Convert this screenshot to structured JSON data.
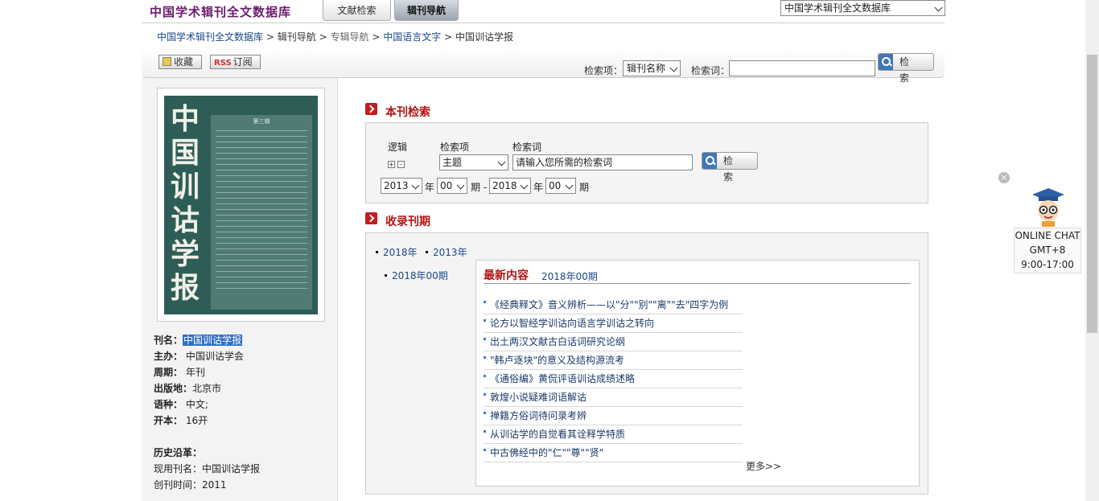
{
  "header": {
    "logo": "中国学术辑刊全文数据库",
    "tabs": [
      "文献检索",
      "辑刊导航"
    ],
    "db_select": "中国学术辑刊全文数据库"
  },
  "breadcrumb": {
    "items": [
      "中国学术辑刊全文数据库",
      "辑刊导航",
      "专辑导航",
      "中国语言文字",
      "中国训诂学报"
    ],
    "sep": ">"
  },
  "toolbar": {
    "fav": "收藏",
    "rss_tag": "RSS",
    "rss": "订阅",
    "search_item_label": "检索项：",
    "search_item_value": "辑刊名称",
    "search_word_label": "检索词：",
    "search_word_value": "",
    "search_btn": "检 索"
  },
  "journal": {
    "cover_title": "中国训诂学报",
    "cover_issue": "第三辑",
    "fields": [
      {
        "label": "刊名：",
        "value": "中国训诂学报"
      },
      {
        "label": "主办：",
        "value": "中国训诂学会"
      },
      {
        "label": "周期：",
        "value": "年刊"
      },
      {
        "label": "出版地：",
        "value": "北京市"
      },
      {
        "label": "语种：",
        "value": "中文;"
      },
      {
        "label": "开本：",
        "value": "16开"
      }
    ],
    "history_title": "历史沿革：",
    "current_name": "现用刊名：中国训诂学报",
    "founded": "创刊时间：2011"
  },
  "search_panel": {
    "title": "本刊检索",
    "logic_label": "逻辑",
    "item_label": "检索项",
    "word_label": "检索词",
    "item_value": "主题",
    "word_placeholder": "请输入您所需的检索词",
    "btn": "检 索",
    "year_from": "2013",
    "issue_from": "00",
    "year_to": "2018",
    "issue_to": "00",
    "year_unit": "年",
    "issue_unit": "期",
    "dash": "期 -"
  },
  "issues": {
    "title": "收录刊期",
    "years": [
      "2018年",
      "2013年"
    ],
    "issue_list": [
      "2018年00期"
    ],
    "latest_title": "最新内容",
    "latest_issue": "2018年00期",
    "articles": [
      "《经典释文》音义辨析——以\"分\"\"别\"\"离\"\"去\"四字为例",
      "论方以智经学训诂向语言学训诂之转向",
      "出土两汉文献古白话词研究论纲",
      "\"韩卢逐块\"的意义及结构源流考",
      "《通俗编》黄侃评语训诂成绩述略",
      "敦煌小说疑难词语解诂",
      "禅籍方俗词待问录考辨",
      "从训诂学的自觉看其诠释学特质",
      "中古佛经中的\"仁\"\"尊\"\"贤\""
    ],
    "more": "更多>>"
  },
  "chat": {
    "close": "×",
    "line1": "ONLINE CHAT",
    "line2": "GMT+8",
    "line3": "9:00-17:00"
  }
}
